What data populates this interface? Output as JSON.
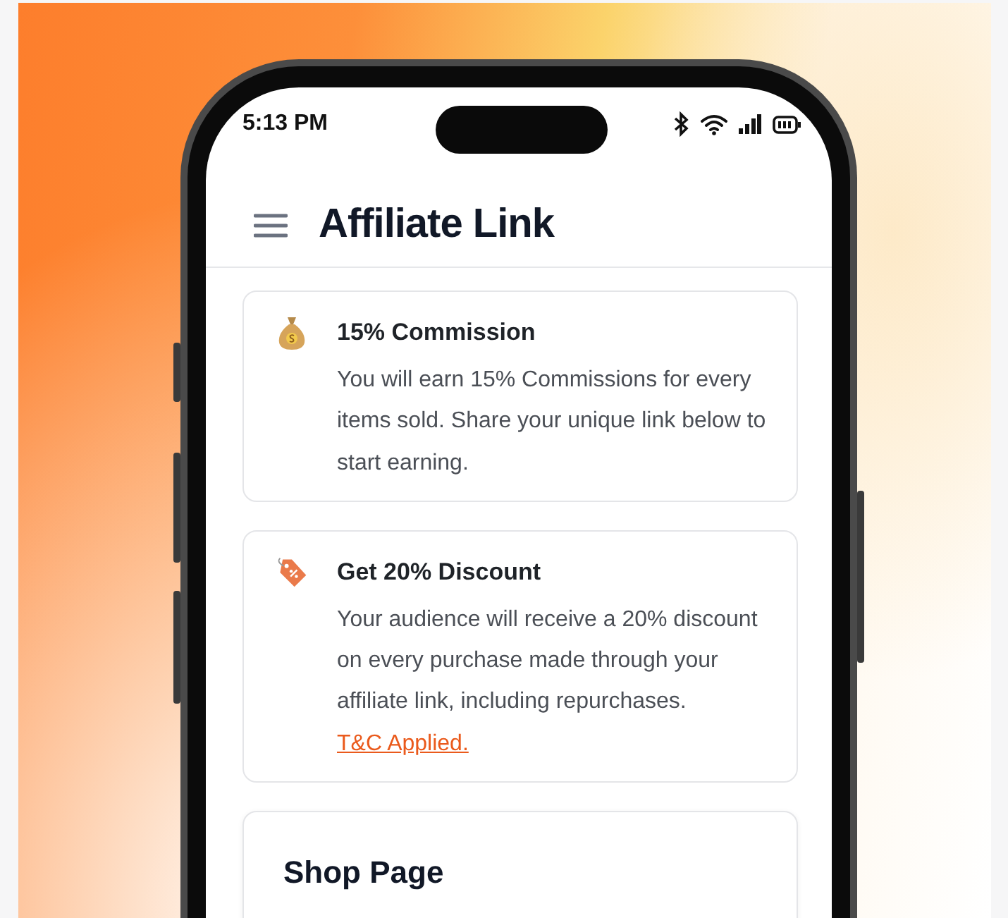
{
  "status_bar": {
    "time": "5:13 PM"
  },
  "header": {
    "title": "Affiliate Link"
  },
  "cards": [
    {
      "kind": "commission",
      "title": "15% Commission",
      "body": "You will earn 15% Commissions for every items sold. Share your unique link below to start earning."
    },
    {
      "kind": "discount",
      "title": "Get 20% Discount",
      "body": "Your audience will receive a 20% discount on every purchase made through your affiliate link, including repurchases.",
      "link": "T&C Applied."
    }
  ],
  "shop_section": {
    "title": "Shop Page"
  }
}
